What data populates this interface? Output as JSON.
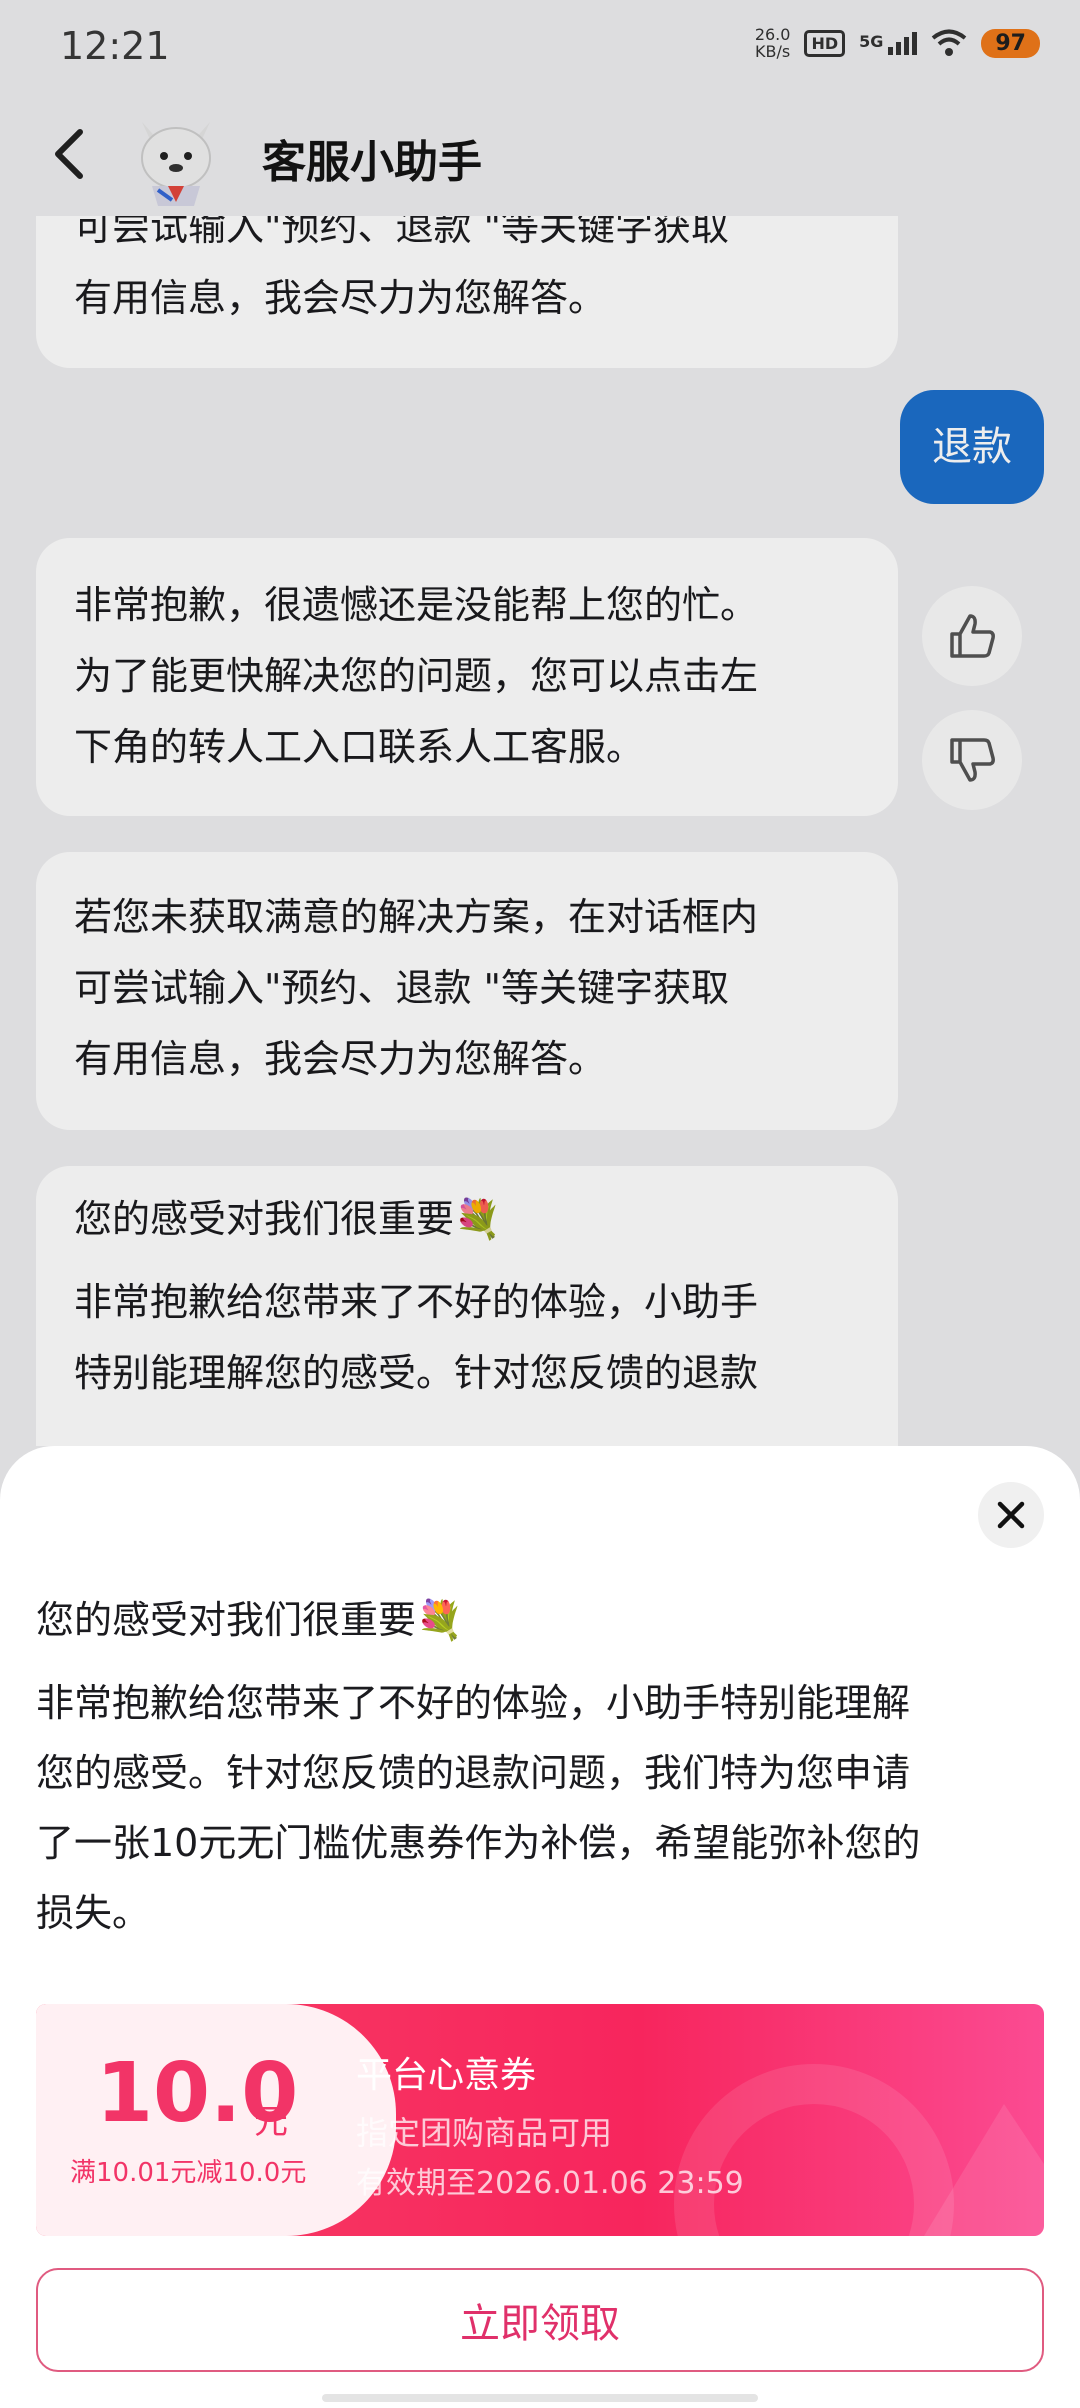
{
  "status_bar": {
    "time": "12:21",
    "speed_value": "26.0",
    "speed_unit": "KB/s",
    "hd": "HD",
    "network": "5G",
    "battery": "97"
  },
  "header": {
    "title": "客服小助手"
  },
  "chat": {
    "top_bubble_lines": [
      "可尝试输入\"预约、退款 \"等关键字获取",
      "有用信息，我会尽力为您解答。"
    ],
    "user_message": "退款",
    "reply_1_lines": [
      "非常抱歉，很遗憾还是没能帮上您的忙。",
      "为了能更快解决您的问题，您可以点击左",
      "下角的转人工入口联系人工客服。"
    ],
    "reply_2_lines": [
      "若您未获取满意的解决方案，在对话框内",
      "可尝试输入\"预约、退款 \"等关键字获取",
      "有用信息，我会尽力为您解答。"
    ],
    "reply_3_heading": "您的感受对我们很重要💐",
    "reply_3_lines": [
      "非常抱歉给您带来了不好的体验，小助手",
      "特别能理解您的感受。针对您反馈的退款"
    ]
  },
  "sheet": {
    "heading": "您的感受对我们很重要💐",
    "body_lines": [
      "非常抱歉给您带来了不好的体验，小助手特别能理解",
      "您的感受。针对您反馈的退款问题，我们特为您申请",
      "了一张10元无门槛优惠券作为补偿，希望能弥补您的",
      "损失。"
    ],
    "coupon": {
      "amount": "10.0",
      "unit": "元",
      "condition": "满10.01元减10.0元",
      "name": "平台心意券",
      "scope": "指定团购商品可用",
      "expiry": "有效期至2026.01.06 23:59"
    },
    "claim_label": "立即领取"
  },
  "colors": {
    "accent": "#e0306a",
    "user_bubble": "#1d6fcc",
    "coupon_red": "#f7255d",
    "battery": "#f07a1a"
  },
  "icons": [
    "back-arrow-icon",
    "thumbs-up-icon",
    "thumbs-down-icon",
    "close-icon",
    "mascot-avatar"
  ]
}
